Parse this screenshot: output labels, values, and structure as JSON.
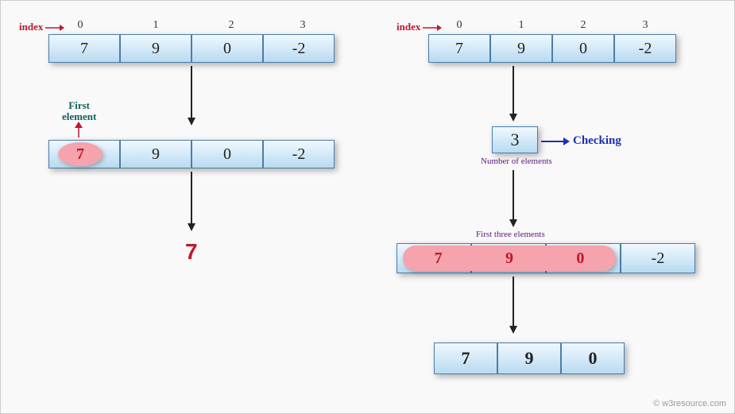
{
  "left": {
    "index_label": "index",
    "indices": [
      "0",
      "1",
      "2",
      "3"
    ],
    "array": [
      "7",
      "9",
      "0",
      "-2"
    ],
    "first_label_line1": "First",
    "first_label_line2": "element",
    "array2": [
      "7",
      "9",
      "0",
      "-2"
    ],
    "highlight_value": "7",
    "result": "7"
  },
  "right": {
    "index_label": "index",
    "indices": [
      "0",
      "1",
      "2",
      "3"
    ],
    "array": [
      "7",
      "9",
      "0",
      "-2"
    ],
    "n_value": "3",
    "checking_label": "Checking",
    "n_label": "Number of elements",
    "first_three_label": "First three elements",
    "array2": [
      "7",
      "9",
      "0",
      "-2"
    ],
    "highlight_values": [
      "7",
      "9",
      "0"
    ],
    "result_array": [
      "7",
      "9",
      "0"
    ]
  },
  "footer": "© w3resource.com",
  "colors": {
    "red": "#c0172c",
    "blue": "#1a2fb5",
    "pink": "#f5a3ad",
    "purple": "#5a1a7a",
    "teal": "#116060"
  }
}
